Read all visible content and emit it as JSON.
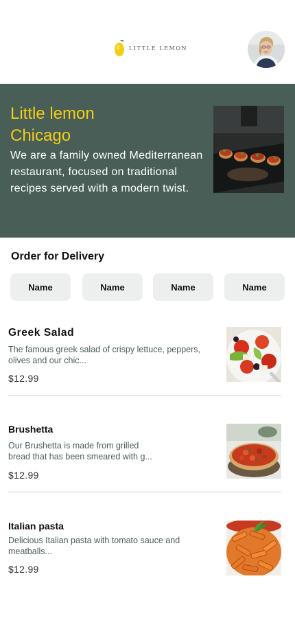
{
  "header": {
    "logo_text": "LITTLE LEMON",
    "logo_icon": "lemon-icon",
    "avatar_alt": "profile-avatar"
  },
  "hero": {
    "title": "Little lemon",
    "subtitle": "Chicago",
    "description": "We are a family owned Mediterranean restaurant, focused on traditional recipes served with a modern twist."
  },
  "order": {
    "title": "Order for Delivery",
    "categories": [
      "Name",
      "Name",
      "Name",
      "Name"
    ]
  },
  "menu": [
    {
      "title": "Greek Salad",
      "description": "The famous greek salad of crispy lettuce, peppers, olives and our chic...",
      "price": "$12.99"
    },
    {
      "title": "Brushetta",
      "description": "Our Brushetta is made from grilled bread that has been smeared with g...",
      "price": "$12.99"
    },
    {
      "title": "Italian pasta",
      "description": "Delicious Italian pasta with tomato sauce and meatballs...",
      "price": "$12.99"
    }
  ],
  "colors": {
    "primary_green": "#495e57",
    "primary_yellow": "#f4ce14",
    "chip_bg": "#edefee"
  }
}
